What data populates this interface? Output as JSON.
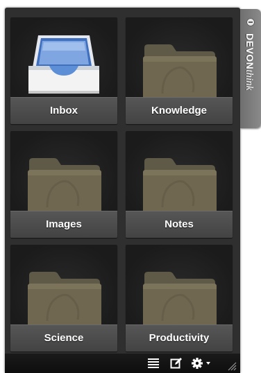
{
  "app": {
    "brand_bold": "DEVON",
    "brand_italic": "think",
    "tab_icon": "minus-circle-icon"
  },
  "databases": [
    {
      "label": "Inbox",
      "icon": "inbox-tray-icon"
    },
    {
      "label": "Knowledge",
      "icon": "folder-icon"
    },
    {
      "label": "Images",
      "icon": "folder-icon"
    },
    {
      "label": "Notes",
      "icon": "folder-icon"
    },
    {
      "label": "Science",
      "icon": "folder-icon"
    },
    {
      "label": "Productivity",
      "icon": "folder-icon"
    }
  ],
  "toolbar": {
    "buttons": [
      "list-icon",
      "compose-icon",
      "gear-menu-icon"
    ],
    "resize": "resize-grip-icon"
  },
  "colors": {
    "panel": "#2f2f2f",
    "tile": "#1d1d1d",
    "label_bar": "#4d4d4d",
    "folder": "#6e6650",
    "tab": "#7d7d7d",
    "inbox_blue": "#5d8fd6"
  }
}
